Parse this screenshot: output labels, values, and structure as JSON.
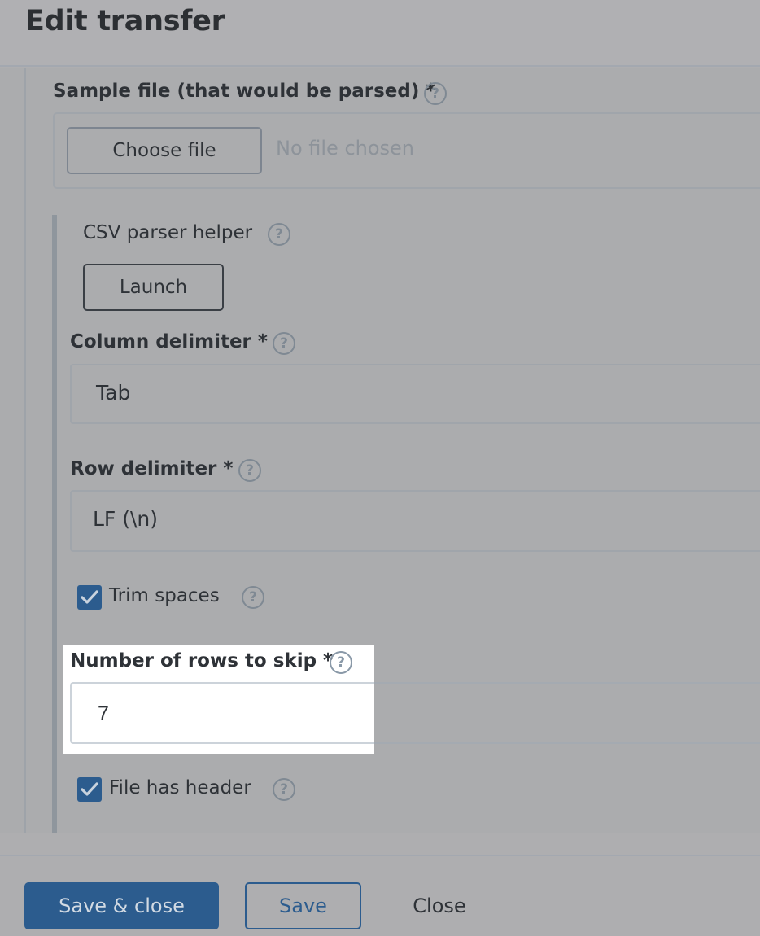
{
  "dialog": {
    "title": "Edit transfer"
  },
  "sample_file": {
    "label": "Sample file (that would be parsed) *",
    "choose_button": "Choose file",
    "status": "No file chosen"
  },
  "csv_helper": {
    "label": "CSV parser helper",
    "launch_button": "Launch"
  },
  "column_delimiter": {
    "label": "Column delimiter *",
    "value": "Tab"
  },
  "row_delimiter": {
    "label": "Row delimiter *",
    "value": "LF (\\n)"
  },
  "trim_spaces": {
    "label": "Trim spaces",
    "checked": true
  },
  "rows_to_skip": {
    "label": "Number of rows to skip *",
    "value": "7"
  },
  "file_has_header": {
    "label": "File has header",
    "checked": true
  },
  "help_glyph": "?",
  "footer": {
    "save_close": "Save & close",
    "save": "Save",
    "close": "Close"
  },
  "colors": {
    "primary": "#2c5c8e",
    "overlay": "#aeaeb0",
    "highlight": "#ffffff"
  }
}
